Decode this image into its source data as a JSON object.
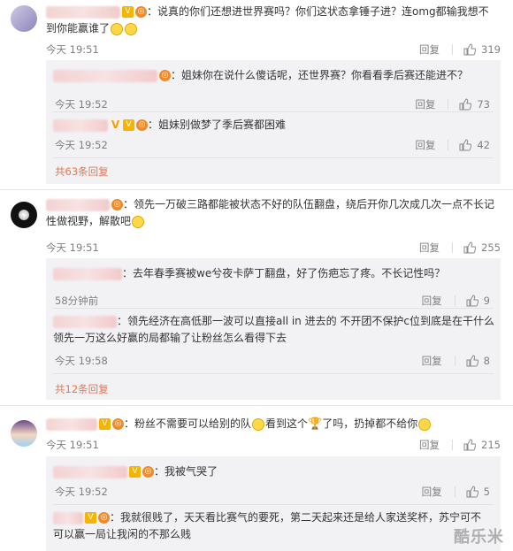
{
  "comments": [
    {
      "text_line1": "：说真的你们还想进世界赛吗？你们这状态拿锤子进？连omg都输我想不",
      "text_line2": "到你能赢谁了",
      "time": "今天 19:51",
      "reply_label": "回复",
      "likes": "319",
      "replies": [
        {
          "text": "：姐妹你在说什么傻话呢，还世界赛？你看看季后赛还能进不？",
          "time": "今天 19:52",
          "reply_label": "回复",
          "likes": "73"
        },
        {
          "text": "：姐妹别做梦了季后赛都困难",
          "time": "今天 19:52",
          "reply_label": "回复",
          "likes": "42"
        }
      ],
      "more_label": "共63条回复"
    },
    {
      "text_line1": "：领先一万破三路都能被状态不好的队伍翻盘，绕后开你几次成几次一点不长记",
      "text_line2": "性做视野，解散吧",
      "time": "今天 19:51",
      "reply_label": "回复",
      "likes": "255",
      "replies": [
        {
          "text": "：去年春季赛被we兮夜卡萨丁翻盘，好了伤疤忘了疼。不长记性吗？",
          "time": "58分钟前",
          "reply_label": "回复",
          "likes": "9"
        },
        {
          "text_line1": "：领先经济在高低那一波可以直接all in 进去的 不开团不保护c位到底是在干什么",
          "text_line2": "领先一万这么好赢的局都输了让粉丝怎么看得下去",
          "time": "今天 19:58",
          "reply_label": "回复",
          "likes": "8"
        }
      ],
      "more_label": "共12条回复"
    },
    {
      "text_a": "：粉丝不需要可以给别的队",
      "text_b": "看到这个",
      "text_c": "了吗，扔掉都不给你",
      "time": "今天 19:51",
      "reply_label": "回复",
      "likes": "215",
      "replies": [
        {
          "text": "：我被气哭了",
          "time": "今天 19:52",
          "reply_label": "回复",
          "likes": "5"
        },
        {
          "text_line1": "：我就很贱了，天天看比赛气的要死，第二天起来还是给人家送奖杯，苏宁可不",
          "text_line2": "可以赢一局让我闲的不那么贱"
        }
      ]
    }
  ],
  "watermark": "酷乐米",
  "colors": {
    "accent": "#eb7350",
    "meta": "#808080",
    "subbox": "#f2f2f5"
  },
  "icons": [
    "thumbs-up-icon",
    "emoji-icon",
    "trophy-icon",
    "vip-badge-icon"
  ]
}
